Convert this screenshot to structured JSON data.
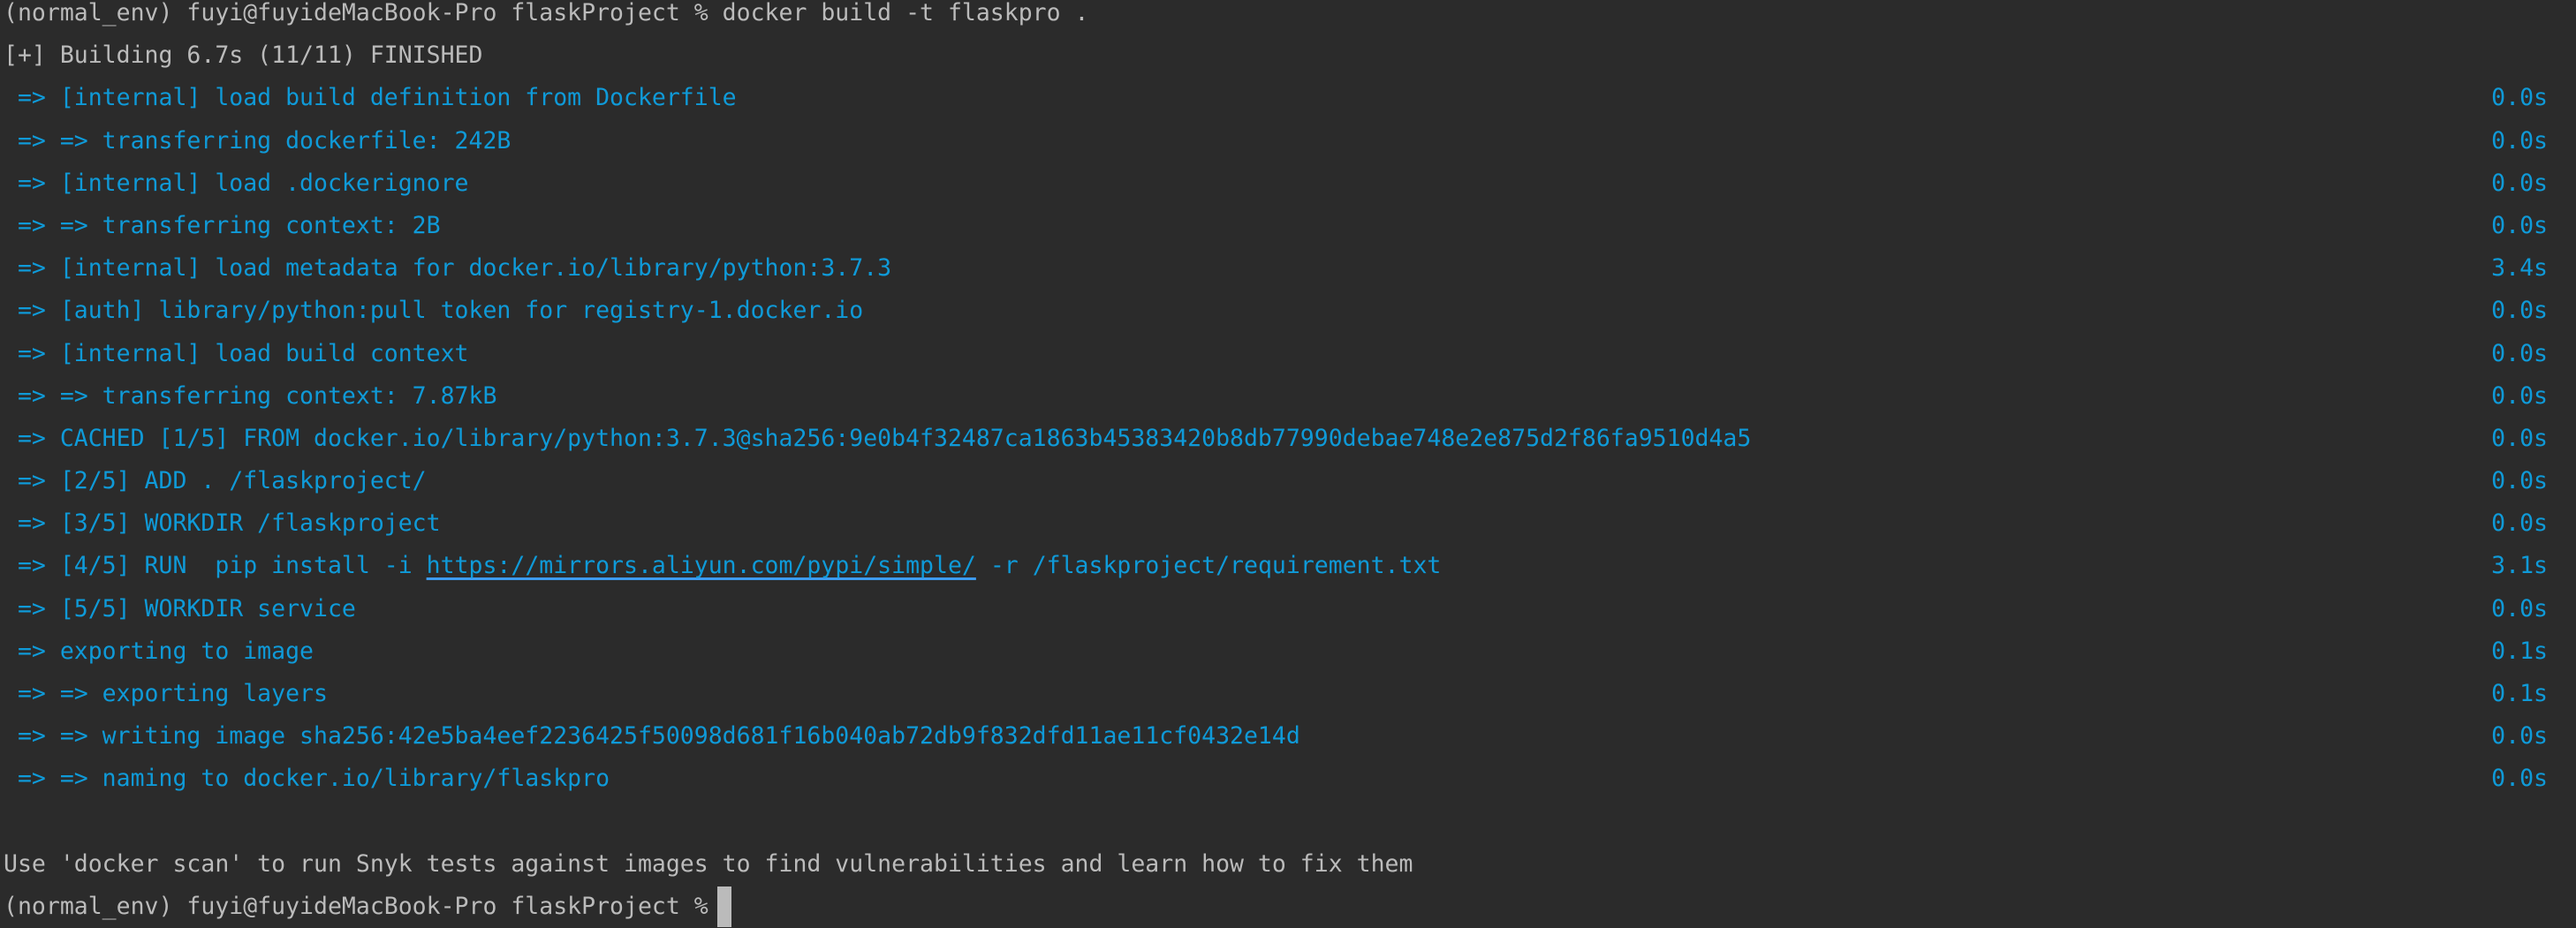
{
  "terminal": {
    "colors": {
      "background": "#2b2b2b",
      "text": "#bbbbbb",
      "build": "#0f9ad8",
      "link_underline": "#3d9bf0"
    },
    "lines": [
      {
        "text": "(normal_env) fuyi@fuyideMacBook-Pro flaskProject % docker build -t flaskpro .",
        "style": "plain"
      },
      {
        "text": "[+] Building 6.7s (11/11) FINISHED",
        "style": "plain"
      },
      {
        "text": " => [internal] load build definition from Dockerfile",
        "time": "0.0s",
        "style": "blue"
      },
      {
        "text": " => => transferring dockerfile: 242B",
        "time": "0.0s",
        "style": "blue"
      },
      {
        "text": " => [internal] load .dockerignore",
        "time": "0.0s",
        "style": "blue"
      },
      {
        "text": " => => transferring context: 2B",
        "time": "0.0s",
        "style": "blue"
      },
      {
        "text": " => [internal] load metadata for docker.io/library/python:3.7.3",
        "time": "3.4s",
        "style": "blue"
      },
      {
        "text": " => [auth] library/python:pull token for registry-1.docker.io",
        "time": "0.0s",
        "style": "blue"
      },
      {
        "text": " => [internal] load build context",
        "time": "0.0s",
        "style": "blue"
      },
      {
        "text": " => => transferring context: 7.87kB",
        "time": "0.0s",
        "style": "blue"
      },
      {
        "text": " => CACHED [1/5] FROM docker.io/library/python:3.7.3@sha256:9e0b4f32487ca1863b45383420b8db77990debae748e2e875d2f86fa9510d4a5",
        "time": "0.0s",
        "style": "blue"
      },
      {
        "text": " => [2/5] ADD . /flaskproject/",
        "time": "0.0s",
        "style": "blue"
      },
      {
        "text": " => [3/5] WORKDIR /flaskproject",
        "time": "0.0s",
        "style": "blue"
      },
      {
        "text": " => [4/5] RUN  pip install -i ",
        "link": "https://mirrors.aliyun.com/pypi/simple/",
        "suffix": " -r /flaskproject/requirement.txt",
        "time": "3.1s",
        "style": "blue"
      },
      {
        "text": " => [5/5] WORKDIR service",
        "time": "0.0s",
        "style": "blue"
      },
      {
        "text": " => exporting to image",
        "time": "0.1s",
        "style": "blue"
      },
      {
        "text": " => => exporting layers",
        "time": "0.1s",
        "style": "blue"
      },
      {
        "text": " => => writing image sha256:42e5ba4eef2236425f50098d681f16b040ab72db9f832dfd11ae11cf0432e14d",
        "time": "0.0s",
        "style": "blue"
      },
      {
        "text": " => => naming to docker.io/library/flaskpro",
        "time": "0.0s",
        "style": "blue"
      },
      {
        "text": "",
        "style": "plain"
      },
      {
        "text": "Use 'docker scan' to run Snyk tests against images to find vulnerabilities and learn how to fix them",
        "style": "plain"
      },
      {
        "text": "(normal_env) fuyi@fuyideMacBook-Pro flaskProject %",
        "style": "plain",
        "cursor": true
      }
    ]
  }
}
